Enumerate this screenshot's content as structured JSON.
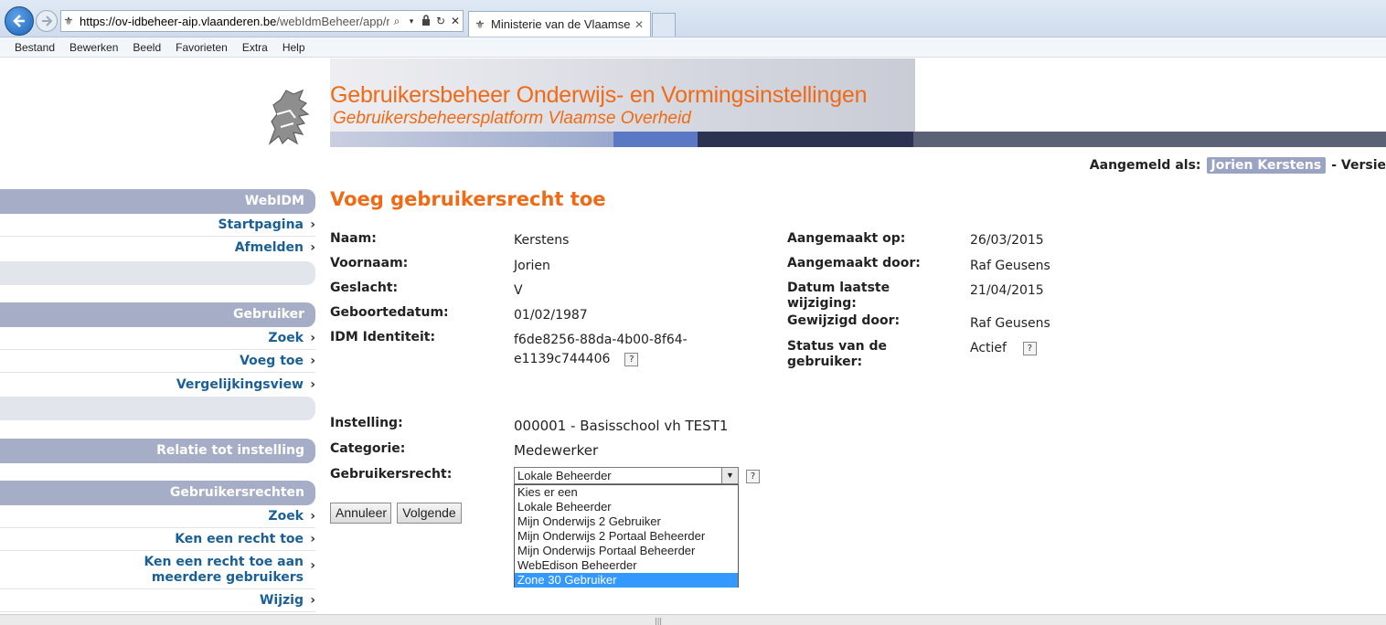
{
  "browser": {
    "url_host": "https://ov-idbeheer-aip.vlaanderen.be",
    "url_rest": "/webIdmBeheer/app/m",
    "tab_title": "Ministerie van de Vlaamse ...",
    "menu": [
      "Bestand",
      "Bewerken",
      "Beeld",
      "Favorieten",
      "Extra",
      "Help"
    ]
  },
  "banner": {
    "title": "Gebruikersbeheer Onderwijs- en Vormingsinstellingen",
    "subtitle": "Gebruikersbeheersplatform Vlaamse Overheid"
  },
  "login": {
    "label": "Aangemeld als:",
    "user": "Jorien Kerstens",
    "suffix": "- Versie"
  },
  "sidebar": {
    "webidm": {
      "title": "WebIDM",
      "items": [
        "Startpagina",
        "Afmelden"
      ]
    },
    "gebruiker": {
      "title": "Gebruiker",
      "items": [
        "Zoek",
        "Voeg toe",
        "Vergelijkingsview"
      ]
    },
    "relatie": {
      "title": "Relatie tot instelling"
    },
    "rechten": {
      "title": "Gebruikersrechten",
      "items": [
        "Zoek",
        "Ken een recht toe",
        "Ken een recht toe aan meerdere gebruikers",
        "Wijzig"
      ]
    }
  },
  "page": {
    "title": "Voeg gebruikersrecht toe",
    "left": [
      {
        "label": "Naam:",
        "value": "Kerstens"
      },
      {
        "label": "Voornaam:",
        "value": "Jorien"
      },
      {
        "label": "Geslacht:",
        "value": "V"
      },
      {
        "label": "Geboortedatum:",
        "value": "01/02/1987"
      },
      {
        "label": "IDM Identiteit:",
        "value_line1": "f6de8256-88da-4b00-8f64-",
        "value_line2": "e1139c744406"
      }
    ],
    "right": [
      {
        "label": "Aangemaakt op:",
        "value": "26/03/2015"
      },
      {
        "label": "Aangemaakt door:",
        "value": "Raf Geusens"
      },
      {
        "label_line1": "Datum laatste",
        "label_line2": "wijziging:",
        "value": "21/04/2015"
      },
      {
        "label": "Gewijzigd door:",
        "value": "Raf Geusens"
      },
      {
        "label_line1": "Status van de",
        "label_line2": "gebruiker:",
        "value": "Actief"
      }
    ],
    "instelling_label": "Instelling:",
    "instelling_value": "000001 - Basisschool vh TEST1",
    "categorie_label": "Categorie:",
    "categorie_value": "Medewerker",
    "recht_label": "Gebruikersrecht:",
    "recht_selected": "Lokale Beheerder",
    "recht_options": [
      "Kies er een",
      "Lokale Beheerder",
      "Mijn Onderwijs 2 Gebruiker",
      "Mijn Onderwijs 2 Portaal Beheerder",
      "Mijn Onderwijs Portaal Beheerder",
      "WebEdison Beheerder",
      "Zone 30 Gebruiker"
    ],
    "highlighted_option": "Zone 30 Gebruiker",
    "help_glyph": "?",
    "btn_cancel": "Annuleer",
    "btn_next": "Volgende"
  },
  "colors": {
    "accent_orange": "#f06a16",
    "sidebar_header": "#a5adc7",
    "link_blue": "#1a5f96",
    "selection_blue": "#3399ff"
  }
}
